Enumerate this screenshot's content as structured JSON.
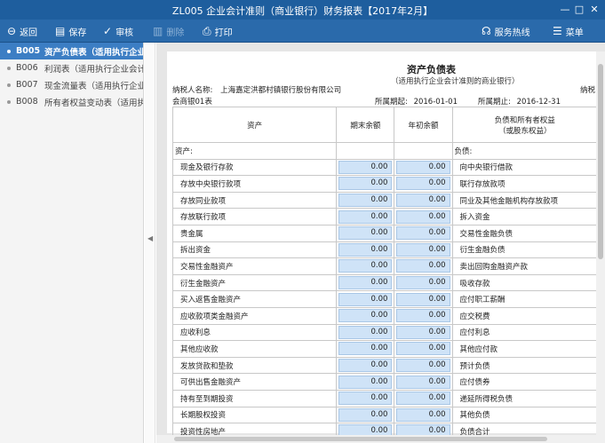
{
  "window": {
    "title": "ZL005 企业会计准则（商业银行）财务报表【2017年2月】",
    "minimize": "—",
    "maximize": "□",
    "close": "✕"
  },
  "toolbar": {
    "back": "返回",
    "save": "保存",
    "review": "审核",
    "delete": "删除",
    "print": "打印",
    "hotline": "服务热线",
    "menu": "菜单"
  },
  "sidebar": {
    "items": [
      {
        "code": "B005",
        "label": "资产负债表（适用执行企业会计准则",
        "active": true
      },
      {
        "code": "B006",
        "label": "利润表（适用执行企业会计准则",
        "active": false
      },
      {
        "code": "B007",
        "label": "现金流量表（适用执行企业会计",
        "active": false
      },
      {
        "code": "B008",
        "label": "所有者权益变动表（适用执行",
        "active": false
      }
    ]
  },
  "report": {
    "title": "资产负债表",
    "subtitle": "（适用执行企业会计准则的商业银行）",
    "taxpayer_label": "纳税人名称:",
    "taxpayer_name": "上海嘉定洪都村镇银行股份有限公司",
    "taxpayer_right": "纳税",
    "form_no": "会商银01表",
    "period_start_label": "所属期起:",
    "period_start": "2016-01-01",
    "period_end_label": "所属期止:",
    "period_end": "2016-12-31",
    "columns": {
      "asset": "资产",
      "end_balance": "期末余额",
      "begin_balance": "年初余额",
      "liability_line1": "负债和所有者权益",
      "liability_line2": "（或股东权益）"
    },
    "section_left": "资产:",
    "section_right": "负债:",
    "rows": [
      {
        "asset": "现金及银行存款",
        "end": "0.00",
        "begin": "0.00",
        "liability": "向中央银行借款"
      },
      {
        "asset": "存放中央银行款项",
        "end": "0.00",
        "begin": "0.00",
        "liability": "联行存放款项"
      },
      {
        "asset": "存放同业款项",
        "end": "0.00",
        "begin": "0.00",
        "liability": "同业及其他金融机构存放款项"
      },
      {
        "asset": "存放联行款项",
        "end": "0.00",
        "begin": "0.00",
        "liability": "拆入资金"
      },
      {
        "asset": "贵金属",
        "end": "0.00",
        "begin": "0.00",
        "liability": "交易性金融负债"
      },
      {
        "asset": "拆出资金",
        "end": "0.00",
        "begin": "0.00",
        "liability": "衍生金融负债"
      },
      {
        "asset": "交易性金融资产",
        "end": "0.00",
        "begin": "0.00",
        "liability": "卖出回购金融资产款"
      },
      {
        "asset": "衍生金融资产",
        "end": "0.00",
        "begin": "0.00",
        "liability": "吸收存款"
      },
      {
        "asset": "买入返售金融资产",
        "end": "0.00",
        "begin": "0.00",
        "liability": "应付职工薪酬"
      },
      {
        "asset": "应收款项类金融资产",
        "end": "0.00",
        "begin": "0.00",
        "liability": "应交税费"
      },
      {
        "asset": "应收利息",
        "end": "0.00",
        "begin": "0.00",
        "liability": "应付利息"
      },
      {
        "asset": "其他应收款",
        "end": "0.00",
        "begin": "0.00",
        "liability": "其他应付款"
      },
      {
        "asset": "发放贷款和垫款",
        "end": "0.00",
        "begin": "0.00",
        "liability": "预计负债"
      },
      {
        "asset": "可供出售金融资产",
        "end": "0.00",
        "begin": "0.00",
        "liability": "应付债券"
      },
      {
        "asset": "持有至到期投资",
        "end": "0.00",
        "begin": "0.00",
        "liability": "递延所得税负债"
      },
      {
        "asset": "长期股权投资",
        "end": "0.00",
        "begin": "0.00",
        "liability": "其他负债"
      },
      {
        "asset": "投资性房地产",
        "end": "0.00",
        "begin": "0.00",
        "liability": "负债合计"
      }
    ]
  }
}
